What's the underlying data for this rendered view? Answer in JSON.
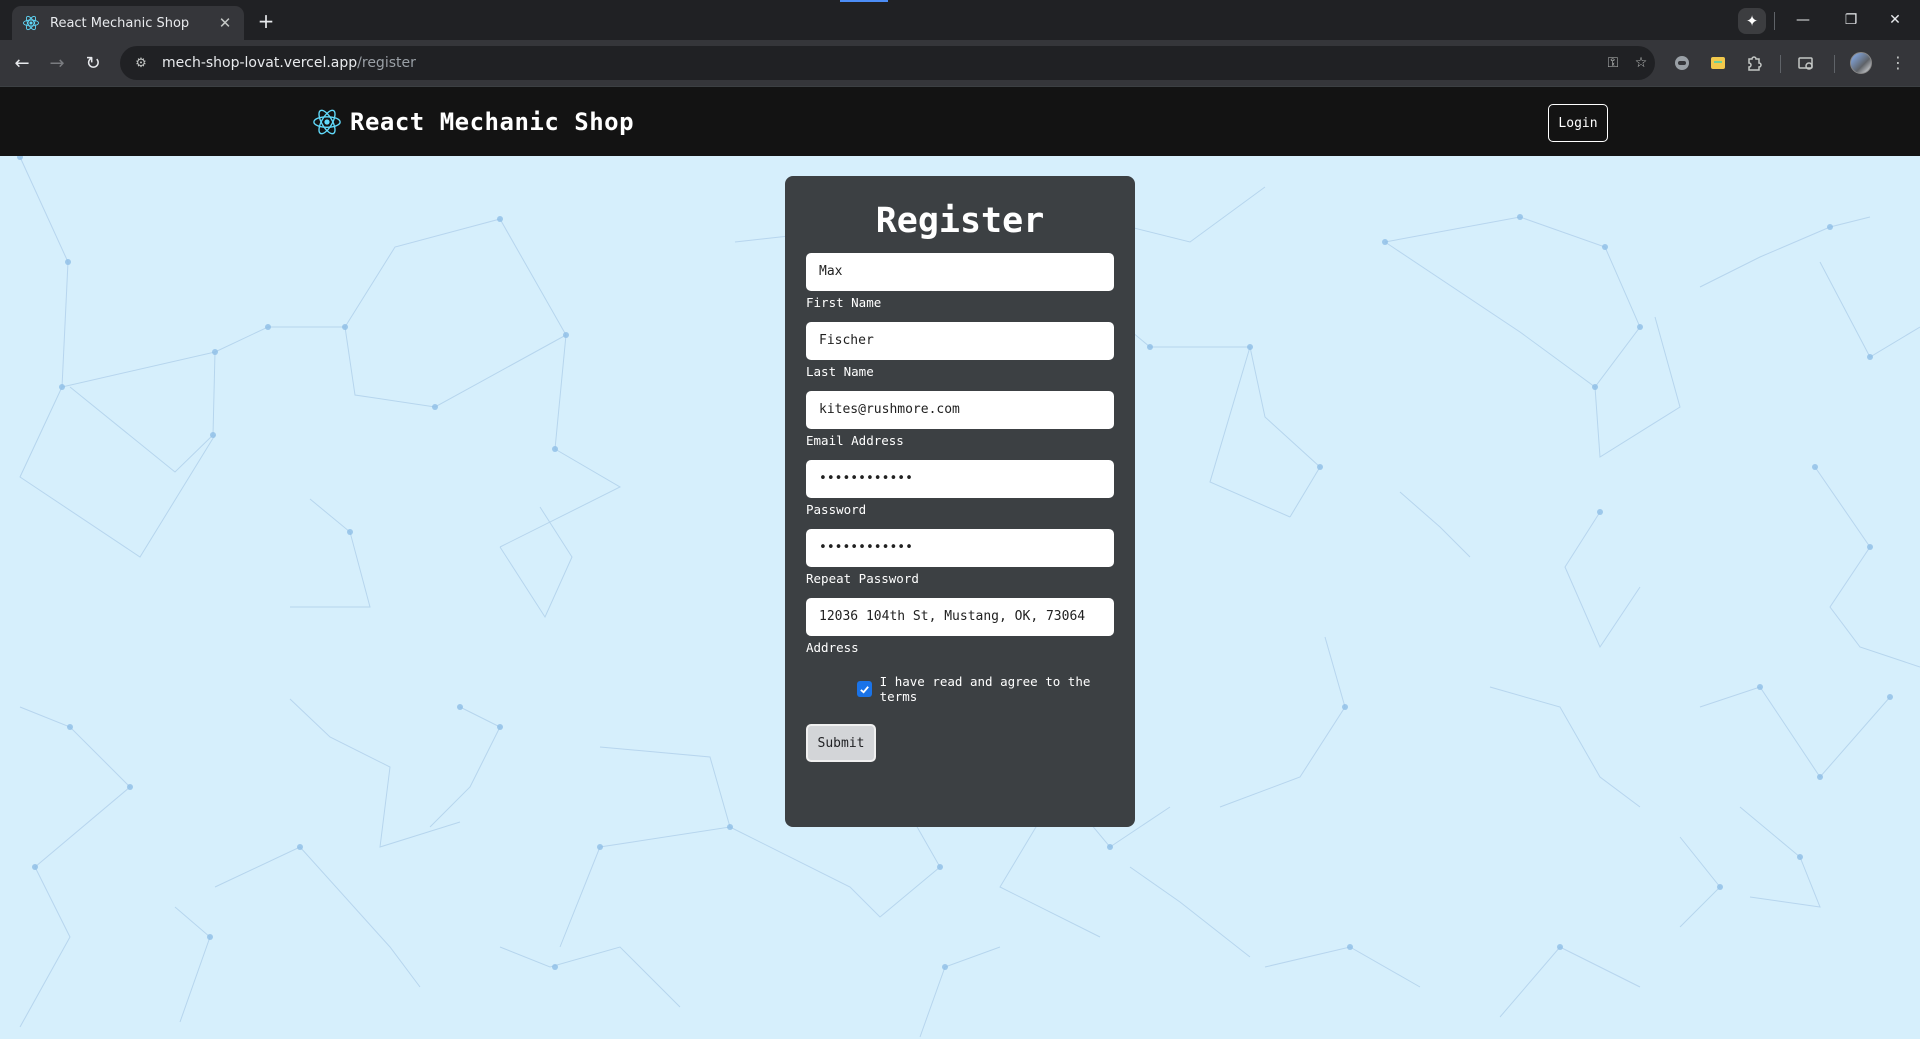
{
  "browser": {
    "tab": {
      "title": "React Mechanic Shop"
    },
    "url": {
      "host": "mech-shop-lovat.vercel.app",
      "path": "/register"
    }
  },
  "navbar": {
    "brand": "React Mechanic Shop",
    "login_label": "Login"
  },
  "form": {
    "title": "Register",
    "fields": [
      {
        "label": "First Name",
        "value": "Max"
      },
      {
        "label": "Last Name",
        "value": "Fischer"
      },
      {
        "label": "Email Address",
        "value": "kites@rushmore.com"
      },
      {
        "label": "Password",
        "value": "••••••••••••"
      },
      {
        "label": "Repeat Password",
        "value": "••••••••••••"
      },
      {
        "label": "Address",
        "value": "12036 104th St, Mustang, OK, 73064"
      }
    ],
    "terms_label": "I have read and agree to the terms",
    "terms_checked": true,
    "submit_label": "Submit"
  },
  "colors": {
    "navbar_bg": "#131313",
    "card_bg": "#3c4043",
    "page_bg": "#d6effc",
    "react_logo": "#61dafb",
    "checkbox": "#1a73e8"
  }
}
